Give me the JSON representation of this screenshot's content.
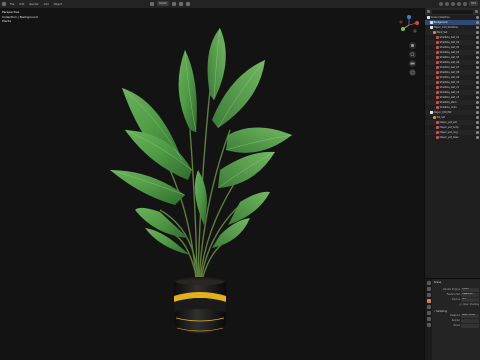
{
  "topbar": {
    "menus": [
      "File",
      "Edit",
      "Render",
      "Add",
      "Object"
    ],
    "mode": "Global",
    "shading": "Hint"
  },
  "viewport": {
    "info": [
      "Perspective",
      "Collection | Background",
      "Plants"
    ]
  },
  "outliner": {
    "rows": [
      {
        "label": "Scene Collection",
        "indent": 0,
        "type": "collection",
        "state": "plain"
      },
      {
        "label": "Background",
        "indent": 1,
        "type": "collection",
        "state": "sel"
      },
      {
        "label": "Dispor_010_Strelitzia",
        "indent": 1,
        "type": "collection",
        "state": "plain"
      },
      {
        "label": "Plant_Set",
        "indent": 2,
        "type": "object",
        "state": "plain"
      },
      {
        "label": "Strelitzia_leaf_01",
        "indent": 3,
        "type": "mesh",
        "state": "plain"
      },
      {
        "label": "Strelitzia_leaf_02",
        "indent": 3,
        "type": "mesh",
        "state": "plain"
      },
      {
        "label": "Strelitzia_leaf_03",
        "indent": 3,
        "type": "mesh",
        "state": "plain"
      },
      {
        "label": "Strelitzia_leaf_04",
        "indent": 3,
        "type": "mesh",
        "state": "plain"
      },
      {
        "label": "Strelitzia_leaf_05",
        "indent": 3,
        "type": "mesh",
        "state": "plain"
      },
      {
        "label": "Strelitzia_leaf_06",
        "indent": 3,
        "type": "mesh",
        "state": "plain"
      },
      {
        "label": "Strelitzia_leaf_07",
        "indent": 3,
        "type": "mesh",
        "state": "plain"
      },
      {
        "label": "Strelitzia_leaf_08",
        "indent": 3,
        "type": "mesh",
        "state": "plain"
      },
      {
        "label": "Strelitzia_leaf_09",
        "indent": 3,
        "type": "mesh",
        "state": "plain"
      },
      {
        "label": "Strelitzia_leaf_10",
        "indent": 3,
        "type": "mesh",
        "state": "plain"
      },
      {
        "label": "Strelitzia_leaf_11",
        "indent": 3,
        "type": "mesh",
        "state": "plain"
      },
      {
        "label": "Strelitzia_leaf_12",
        "indent": 3,
        "type": "mesh",
        "state": "plain"
      },
      {
        "label": "Strelitzia_leaf_13",
        "indent": 3,
        "type": "mesh",
        "state": "plain"
      },
      {
        "label": "Strelitzia_stem",
        "indent": 3,
        "type": "mesh",
        "state": "plain"
      },
      {
        "label": "Strelitzia_roots",
        "indent": 3,
        "type": "mesh",
        "state": "plain"
      },
      {
        "label": "Dispor_010_Pot",
        "indent": 1,
        "type": "collection",
        "state": "plain"
      },
      {
        "label": "Pot_Set",
        "indent": 2,
        "type": "object",
        "state": "plain"
      },
      {
        "label": "Dispor_pot_soil",
        "indent": 3,
        "type": "mesh",
        "state": "plain"
      },
      {
        "label": "Dispor_pot_body",
        "indent": 3,
        "type": "mesh",
        "state": "plain"
      },
      {
        "label": "Dispor_pot_ring",
        "indent": 3,
        "type": "mesh",
        "state": "plain"
      },
      {
        "label": "Dispor_pot_base",
        "indent": 3,
        "type": "mesh",
        "state": "plain"
      }
    ]
  },
  "properties": {
    "title": "Scene",
    "fields": [
      {
        "label": "Render Engine",
        "value": "Cycles"
      },
      {
        "label": "Feature Set",
        "value": "Supported"
      },
      {
        "label": "Device",
        "value": "GPU"
      }
    ],
    "check_label": "Open Shading",
    "section": "Sampling",
    "sub_fields": [
      {
        "label": "Viewport",
        "value": "Noise Thresh"
      },
      {
        "label": "Render",
        "value": ""
      },
      {
        "label": "Noise",
        "value": ""
      }
    ]
  },
  "colors": {
    "accent": "#2f4a74",
    "leaf": "#4f9a45",
    "pot_ring": "#e3b21a",
    "axis_x": "#d2434a",
    "axis_y": "#7fbf3a",
    "axis_z": "#3b7fe0"
  },
  "icons": [
    "app-icon",
    "grid-icon",
    "eye-icon",
    "camera-icon",
    "hand-icon",
    "zoom-icon",
    "gizmo-icon",
    "scene-icon"
  ]
}
